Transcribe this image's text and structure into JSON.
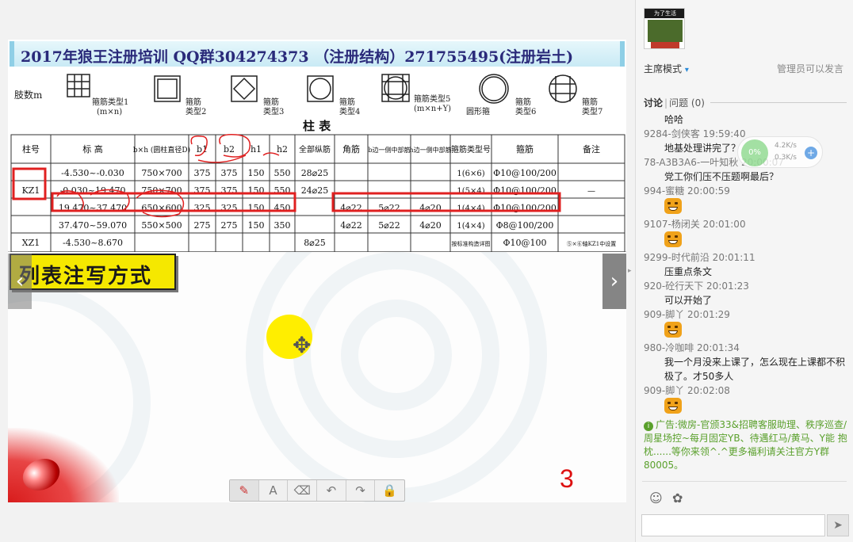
{
  "slide": {
    "title": "2017年狼王注册培训  QQ群304274373    （注册结构）271755495(注册岩土)",
    "label": "列表注写方式",
    "page_number": "3",
    "figure": {
      "layer_label": "肢数m",
      "stirrup_types": [
        {
          "name": "箍筋类型1",
          "sub": "(m×n)"
        },
        {
          "name": "箍筋",
          "sub": "类型2"
        },
        {
          "name": "箍筋",
          "sub": "类型3"
        },
        {
          "name": "箍筋",
          "sub": "类型4"
        },
        {
          "name": "箍筋类型5",
          "sub": "(m×n+Y)"
        },
        {
          "name": "圆形箍",
          "sub": ""
        },
        {
          "name": "箍筋",
          "sub": "类型6"
        },
        {
          "name": "箍筋",
          "sub": "类型7"
        }
      ],
      "table_title": "柱  表",
      "headers": [
        "柱号",
        "标 高",
        "b×h (圆柱直径D)",
        "b1",
        "b2",
        "h1",
        "h2",
        "全部纵筋",
        "角筋",
        "b边一侧中部筋",
        "h边一侧中部筋",
        "箍筋类型号",
        "箍筋",
        "备注"
      ],
      "rows": [
        [
          "",
          "-4.530~-0.030",
          "750×700",
          "375",
          "375",
          "150",
          "550",
          "28⌀25",
          "",
          "",
          "",
          "1(6×6)",
          "Φ10@100/200",
          ""
        ],
        [
          "KZ1",
          "-0.030~19.470",
          "750×700",
          "375",
          "375",
          "150",
          "550",
          "24⌀25",
          "",
          "",
          "",
          "1(5×4)",
          "Φ10@100/200",
          "—"
        ],
        [
          "",
          "19.470~37.470",
          "650×600",
          "325",
          "325",
          "150",
          "450",
          "",
          "4⌀22",
          "5⌀22",
          "4⌀20",
          "1(4×4)",
          "Φ10@100/200",
          ""
        ],
        [
          "",
          "37.470~59.070",
          "550×500",
          "275",
          "275",
          "150",
          "350",
          "",
          "4⌀22",
          "5⌀22",
          "4⌀20",
          "1(4×4)",
          "Φ8@100/200",
          ""
        ],
        [
          "XZ1",
          "-4.530~8.670",
          "",
          "",
          "",
          "",
          "",
          "8⌀25",
          "",
          "",
          "",
          "按标准构造详图",
          "Φ10@100",
          "⑤×⑥轴KZ1中设置"
        ]
      ]
    }
  },
  "toolbar": {
    "pen": "✎",
    "text": "A",
    "eraser": "⌫",
    "undo": "↶",
    "redo": "↷",
    "lock": "🔒"
  },
  "nav": {
    "prev": "‹",
    "next": "›"
  },
  "panel": {
    "avatar_text": "为了生活",
    "mode_label": "主席模式",
    "admin_note": "管理员可以发言",
    "tab_discuss": "讨论",
    "tab_question": "问题",
    "question_count": "(0)",
    "messages": [
      {
        "type": "text",
        "body": "哈哈"
      },
      {
        "type": "meta",
        "body": "9284-剑侠客 19:59:40"
      },
      {
        "type": "text",
        "body": "地基处理讲完了？"
      },
      {
        "type": "meta",
        "body": "78-A3B3A6-一叶知秋 20:00:07"
      },
      {
        "type": "text",
        "body": "党工你们压不压题啊最后？"
      },
      {
        "type": "meta",
        "body": "994-蜜糖 20:00:59"
      },
      {
        "type": "emoji"
      },
      {
        "type": "meta",
        "body": "9107-杨闭关 20:01:00"
      },
      {
        "type": "emoji"
      },
      {
        "type": "meta",
        "body": "9299-时代前沿 20:01:11"
      },
      {
        "type": "text",
        "body": "压重点条文"
      },
      {
        "type": "meta",
        "body": "920-砼行天下 20:01:23"
      },
      {
        "type": "text",
        "body": "可以开始了"
      },
      {
        "type": "meta",
        "body": "909-脚丫 20:01:29"
      },
      {
        "type": "emoji"
      },
      {
        "type": "meta",
        "body": "980-冷咖啡 20:01:34"
      },
      {
        "type": "text",
        "body": "我一个月没来上课了，怎么现在上课都不积极了。才50多人"
      },
      {
        "type": "meta",
        "body": "909-脚丫 20:02:08"
      },
      {
        "type": "emoji"
      }
    ],
    "ad": "广告:微房-官颁33&招聘客服助理、秩序巡查/周星场控~每月固定YB、待遇红马/黄马、Y能 抱枕......等你来领^.^更多福利请关注官方Y群80005。",
    "net": {
      "percent": "0%",
      "up": "4.2K/s",
      "down": "0.3K/s",
      "plus": "+"
    },
    "send": "➤",
    "face_icon": "☺",
    "gift_icon": "✿"
  }
}
